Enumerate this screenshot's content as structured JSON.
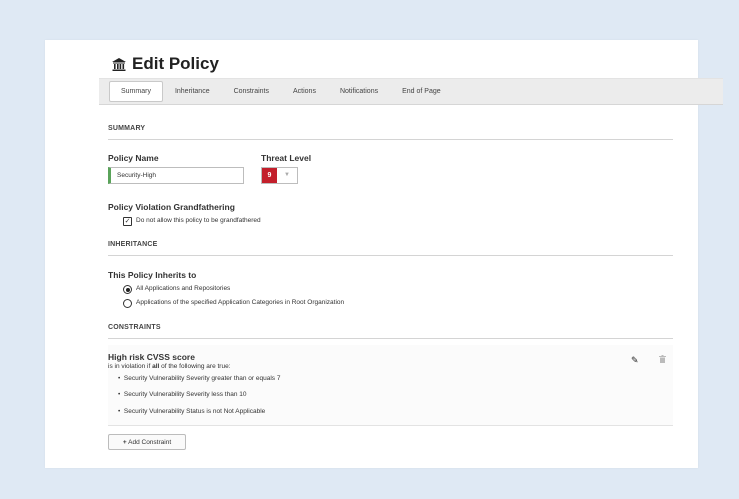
{
  "page": {
    "title": "Edit Policy",
    "title_icon": "bank-icon"
  },
  "tabs": [
    {
      "label": "Summary",
      "active": true
    },
    {
      "label": "Inheritance"
    },
    {
      "label": "Constraints"
    },
    {
      "label": "Actions"
    },
    {
      "label": "Notifications"
    },
    {
      "label": "End of Page"
    }
  ],
  "summary": {
    "header": "SUMMARY",
    "policy_name_label": "Policy Name",
    "policy_name_value": "Security-High",
    "threat_level_label": "Threat Level",
    "threat_level_value": "9",
    "threat_level_color": "#c31f2b",
    "grandfathering_label": "Policy Violation Grandfathering",
    "grandfathering_checkbox_label": "Do not allow this policy to be grandfathered",
    "grandfathering_checked": true
  },
  "inheritance": {
    "header": "INHERITANCE",
    "label": "This Policy Inherits to",
    "options": [
      {
        "label": "All Applications and Repositories",
        "selected": true
      },
      {
        "label": "Applications of the specified Application Categories in Root Organization",
        "selected": false
      }
    ]
  },
  "constraints": {
    "header": "CONSTRAINTS",
    "items": [
      {
        "name": "High risk CVSS score",
        "condition_prefix": "is in violation if ",
        "condition_bold": "all",
        "condition_suffix": " of the following are true:",
        "conditions": [
          "Security Vulnerability Severity greater than or equals 7",
          "Security Vulnerability Severity less than 10",
          "Security Vulnerability Status is not Not Applicable"
        ]
      }
    ],
    "add_button_label": "Add Constraint"
  },
  "colors": {
    "background": "#dfe9f4",
    "accent_green": "#5aa35a",
    "threat_red": "#c31f2b"
  }
}
